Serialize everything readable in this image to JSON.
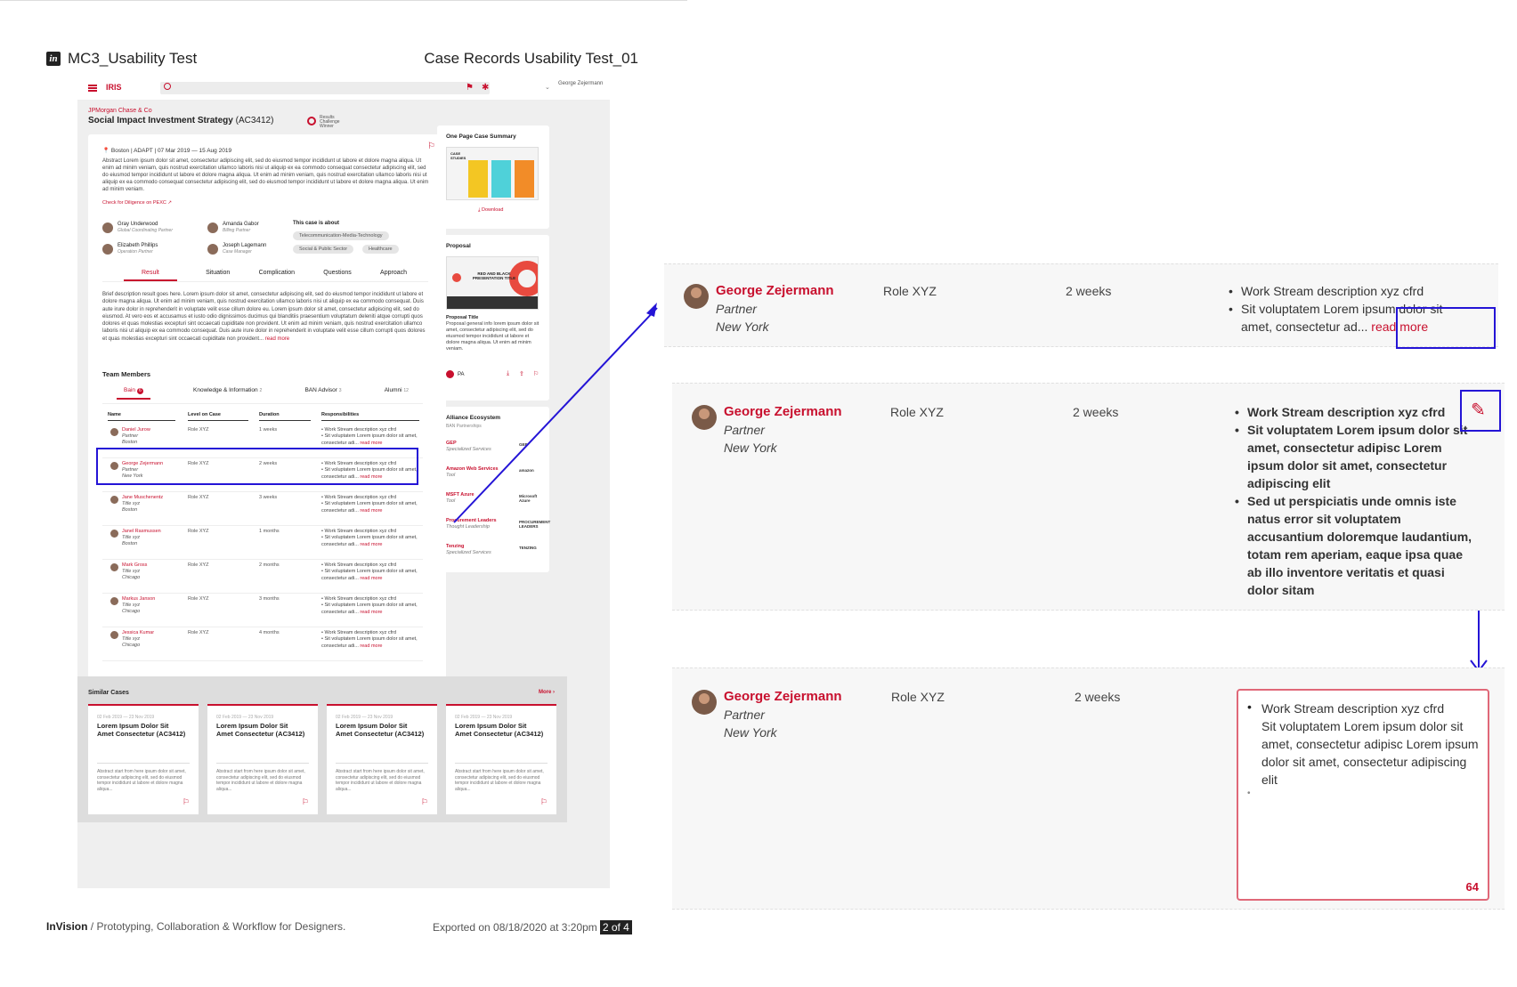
{
  "doc": {
    "left_title": "MC3_Usability Test",
    "right_title": "Case Records Usability Test_01",
    "footer_brand": "InVision",
    "footer_tagline": " / Prototyping, Collaboration & Workflow for Designers.",
    "footer_export": "Exported on 08/18/2020 at 3:20pm",
    "footer_page": "2 of 4"
  },
  "app": {
    "brand": "IRIS",
    "user": "George Zejermann",
    "client": "JPMorgan Chase & Co",
    "case_title": "Social Impact Investment Strategy",
    "case_code": "(AC3412)",
    "badge_text": "Results Challenge Winner",
    "meta": "Boston  |  ADAPT  |  07 Mar 2019 — 15 Aug 2019",
    "abstract": "Abstract Lorem ipsum dolor sit amet, consectetur adipiscing elit, sed do eiusmod tempor incididunt ut labore et dolore magna aliqua. Ut enim ad minim veniam, quis nostrud exercitation ullamco laboris nisi ut aliquip ex ea commodo consequat consectetur adipiscing elit, sed do eiusmod tempor incididunt ut labore et dolore magna aliqua. Ut enim ad minim veniam, quis nostrud exercitation ullamco laboris nisi ut aliquip ex ea commodo consequat consectetur adipiscing elit, sed do eiusmod tempor incididunt ut labore et dolore magna aliqua. Ut enim ad minim veniam.",
    "diligence_link": "Check for Diligence on PEXC ↗",
    "people": [
      {
        "name": "Gray Underwood",
        "role": "Global Coordinating Partner"
      },
      {
        "name": "Amanda Gabor",
        "role": "Billing Partner"
      },
      {
        "name": "Elizabeth Phillips",
        "role": "Operation Partner"
      },
      {
        "name": "Joseph Lagemann",
        "role": "Case Manager"
      }
    ],
    "about_label": "This case is about",
    "tags": [
      "Telecommunication-Media-Technology",
      "Social & Public Sector",
      "Healthcare"
    ],
    "tabs": [
      "Result",
      "Situation",
      "Complication",
      "Questions",
      "Approach"
    ],
    "brief": "Brief description result goes here. Lorem ipsum dolor sit amet, consectetur adipiscing elit, sed do eiusmod tempor incididunt ut labore et dolore magna aliqua. Ut enim ad minim veniam, quis nostrud exercitation ullamco laboris nisi ut aliquip ex ea commodo consequat. Duis aute irure dolor in reprehenderit in voluptate velit esse cillum dolore eu. Lorem ipsum dolor sit amet, consectetur adipiscing elit, sed do eiusmod. At vero eos et accusamus et iusto odio dignissimos ducimus qui blanditiis praesentium voluptatum deleniti atque corrupti quos dolores et quas molestias excepturi sint occaecati cupiditate non provident. Ut enim ad minim veniam, quis nostrud exercitation ullamco laboris nisi ut aliquip ex ea commodo consequat. Duis aute irure dolor in reprehenderit in voluptate velit esse cillum  corrupti quos dolores et quas molestias excepturi sint occaecati cupiditate non provident...",
    "brief_more": "read more",
    "team_title": "Team Members",
    "team_tabs": [
      {
        "label": "Bain",
        "count": "6"
      },
      {
        "label": "Knowledge & Information",
        "count": "2"
      },
      {
        "label": "BAN Advisor",
        "count": "3"
      },
      {
        "label": "Alumni",
        "count": "12"
      }
    ],
    "table_headers": [
      "Name",
      "Level on Case",
      "Duration",
      "Responsibilities"
    ],
    "rows": [
      {
        "name": "Daniel Jurow",
        "title": "Partner",
        "loc": "Boston",
        "role": "Role XYZ",
        "dur": "1 weeks"
      },
      {
        "name": "George Zejermann",
        "title": "Partner",
        "loc": "New York",
        "role": "Role XYZ",
        "dur": "2 weeks"
      },
      {
        "name": "Jane Muschenentz",
        "title": "Title xyz",
        "loc": "Boston",
        "role": "Role XYZ",
        "dur": "3 weeks"
      },
      {
        "name": "Janel Rasmussen",
        "title": "Title xyz",
        "loc": "Boston",
        "role": "Role XYZ",
        "dur": "1 months"
      },
      {
        "name": "Mark Gross",
        "title": "Title xyz",
        "loc": "Chicago",
        "role": "Role XYZ",
        "dur": "2 months"
      },
      {
        "name": "Markus Janson",
        "title": "Title xyz",
        "loc": "Chicago",
        "role": "Role XYZ",
        "dur": "3 months"
      },
      {
        "name": "Jessica Kumar",
        "title": "Title xyz",
        "loc": "Chicago",
        "role": "Role XYZ",
        "dur": "4 months"
      }
    ],
    "row_resp": [
      "Work Stream description xyz cfrd",
      "Sit voluptatem Lorem ipsum dolor sit amet, consectetur adi..."
    ],
    "row_more": "read more",
    "summary_title": "One Page Case Summary",
    "summary_img_label": "CASE STUDIES",
    "download": "Download",
    "proposal_title": "Proposal",
    "proposal_img_text": "RED AND BLACK PRESENTATION TITLE",
    "proposal_name": "Proposal Title",
    "proposal_desc": "Proposal general info lorem ipsum dolor sit amet, consectetur adipiscing elit, sed do eiusmod tempor incididunt ut labore et dolore magna aliqua. Ut enim ad minim veniam.",
    "proposal_pa": "PA",
    "alliance_title": "Alliance Ecosystem",
    "alliance_sub": "BAN Partnerships",
    "alliances": [
      {
        "name": "GEP",
        "type": "Specialized Services",
        "logo": "GEP"
      },
      {
        "name": "Amazon Web Services",
        "type": "Tool",
        "logo": "amazon"
      },
      {
        "name": "MSFT Azure",
        "type": "Tool",
        "logo": "Microsoft Azure"
      },
      {
        "name": "Procurement Leaders",
        "type": "Thought Leadership",
        "logo": "PROCUREMENT LEADERS"
      },
      {
        "name": "Tenzing",
        "type": "Specialized Services",
        "logo": "TENZING"
      }
    ],
    "similar_title": "Similar Cases",
    "similar_more": "More",
    "similar_cards": [
      {
        "date": "02 Feb 2019 — 23 Nov 2019",
        "title": "Lorem Ipsum Dolor Sit Amet Consectetur (AC3412)",
        "abstract": "Abstract start from here ipsum dolor sit amet, consectetur adipiscing elit, sed do eiusmod tempor incididunt ut labore et dolore magna aliqua..."
      },
      {
        "date": "02 Feb 2019 — 23 Nov 2019",
        "title": "Lorem Ipsum Dolor Sit Amet Consectetur (AC3412)",
        "abstract": "Abstract start from here ipsum dolor sit amet, consectetur adipiscing elit, sed do eiusmod tempor incididunt ut labore et dolore magna aliqua..."
      },
      {
        "date": "02 Feb 2019 — 23 Nov 2019",
        "title": "Lorem Ipsum Dolor Sit Amet Consectetur (AC3412)",
        "abstract": "Abstract start from here ipsum dolor sit amet, consectetur adipiscing elit, sed do eiusmod tempor incididunt ut labore et dolore magna aliqua..."
      },
      {
        "date": "02 Feb 2019 — 23 Nov 2019",
        "title": "Lorem Ipsum Dolor Sit Amet Consectetur (AC3412)",
        "abstract": "Abstract start from here ipsum dolor sit amet, consectetur adipiscing elit, sed do eiusmod tempor incididunt ut labore et dolore magna aliqua..."
      }
    ]
  },
  "zoom": {
    "name": "George Zejermann",
    "title": "Partner",
    "location": "New York",
    "role": "Role XYZ",
    "duration": "2 weeks",
    "collapsed": [
      "Work Stream description xyz cfrd",
      "Sit voluptatem Lorem ipsum dolor sit amet, consectetur ad..."
    ],
    "read_more": "read more",
    "expanded": [
      "Work Stream description xyz cfrd",
      "Sit voluptatem Lorem ipsum dolor sit amet, consectetur adipisc Lorem ipsum dolor sit amet, consectetur adipiscing elit",
      "Sed ut perspiciatis unde omnis iste natus error sit voluptatem accusantium doloremque laudantium, totam rem aperiam, eaque ipsa quae ab illo inventore veritatis et quasi dolor sitam"
    ],
    "editor_bullet": "Work Stream description xyz cfrd",
    "editor_text": "Sit voluptatem Lorem ipsum dolor sit amet, consectetur adipisc Lorem ipsum dolor sit amet, consectetur adipiscing elit",
    "counter": "64"
  },
  "colors": {
    "accent": "#c8102e",
    "annotation": "#2414d6"
  }
}
